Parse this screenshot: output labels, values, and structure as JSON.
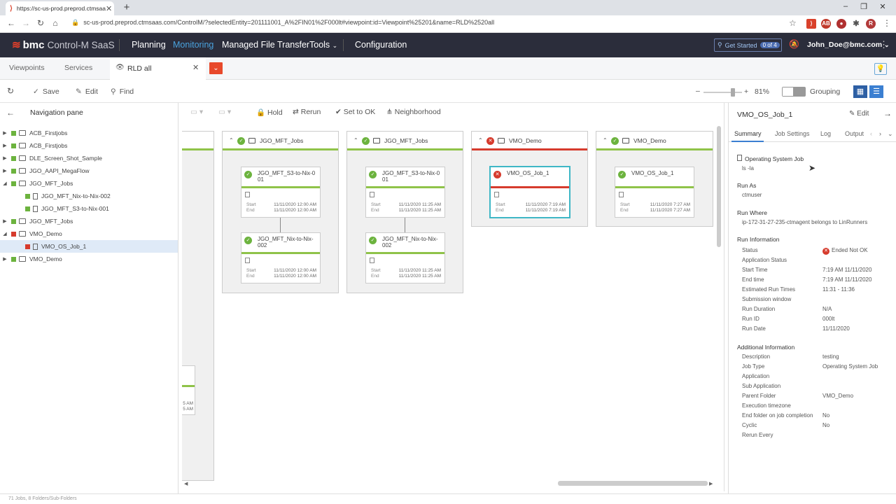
{
  "browser": {
    "tab_title": "https://sc-us-prod.preprod.ctmsaa",
    "url": "sc-us-prod.preprod.ctmsaas.com/ControlM/?selectedEntity=201111001_A%2FIN01%2F000lt#viewpoint:id=Viewpoint%25201&name=RLD%2520all",
    "profile_initial": "R"
  },
  "header": {
    "brand": "bmc",
    "product": "Control-M SaaS",
    "menu": [
      "Planning",
      "Monitoring",
      "Managed File Transfer",
      "Tools",
      "Configuration"
    ],
    "active_menu": "Monitoring",
    "get_started": "Get Started",
    "get_started_count": "0 of 4",
    "user": "John_Doe@bmc.com"
  },
  "viewpoint_tabs": {
    "viewpoints": "Viewpoints",
    "services": "Services",
    "active": "RLD all"
  },
  "toolbar": {
    "save": "Save",
    "edit": "Edit",
    "find": "Find",
    "zoom": "81%",
    "grouping": "Grouping"
  },
  "nav": {
    "title": "Navigation pane",
    "items": [
      {
        "label": "ACB_Firstjobs",
        "status": "ok"
      },
      {
        "label": "ACB_Firstjobs",
        "status": "ok"
      },
      {
        "label": "DLE_Screen_Shot_Sample",
        "status": "ok"
      },
      {
        "label": "JGO_AAPI_MegaFlow",
        "status": "ok"
      },
      {
        "label": "JGO_MFT_Jobs",
        "status": "ok"
      },
      {
        "label": "JGO_MFT_Nix-to-Nix-002",
        "status": "ok"
      },
      {
        "label": "JGO_MFT_S3-to-Nix-001",
        "status": "ok"
      },
      {
        "label": "JGO_MFT_Jobs",
        "status": "ok"
      },
      {
        "label": "VMO_Demo",
        "status": "fail"
      },
      {
        "label": "VMO_OS_Job_1",
        "status": "fail"
      },
      {
        "label": "VMO_Demo",
        "status": "ok"
      }
    ]
  },
  "canvas_toolbar": {
    "hold": "Hold",
    "rerun": "Rerun",
    "set_to_ok": "Set to OK",
    "neighborhood": "Neighborhood"
  },
  "folders": [
    {
      "name": "JGO_MFT_Jobs",
      "jobs": [
        {
          "name": "JGO_MFT_S3-to-Nix-0 01",
          "start": "11/11/2020 12:00 AM",
          "end": "11/11/2020 12:00 AM"
        },
        {
          "name": "JGO_MFT_Nix-to-Nix-002",
          "start": "11/11/2020 12:00 AM",
          "end": "11/11/2020 12:00 AM"
        }
      ]
    },
    {
      "name": "JGO_MFT_Jobs",
      "jobs": [
        {
          "name": "JGO_MFT_S3-to-Nix-0 01",
          "start": "11/11/2020 11:25 AM",
          "end": "11/11/2020 11:25 AM"
        },
        {
          "name": "JGO_MFT_Nix-to-Nix-002",
          "start": "11/11/2020 11:25 AM",
          "end": "11/11/2020 11:25 AM"
        }
      ]
    },
    {
      "name": "VMO_Demo",
      "jobs": [
        {
          "name": "VMO_OS_Job_1",
          "start": "11/11/2020 7:19 AM",
          "end": "11/11/2020 7:19 AM"
        }
      ]
    },
    {
      "name": "VMO_Demo",
      "jobs": [
        {
          "name": "VMO_OS_Job_1",
          "start": "11/11/2020 7:27 AM",
          "end": "11/11/2020 7:27 AM"
        }
      ]
    }
  ],
  "job_labels": {
    "start": "Start",
    "end": "End"
  },
  "partial_job_times": {
    "start": "5 AM",
    "end": "5 AM"
  },
  "status_bar": "71 Jobs, 8 Folders/Sub-Folders",
  "detail": {
    "title": "VMO_OS_Job_1",
    "edit": "Edit",
    "tabs": [
      "Summary",
      "Job Settings",
      "Log",
      "Output"
    ],
    "job_kind": "Operating System Job",
    "command": "ls -la",
    "run_as_label": "Run As",
    "run_as": "ctmuser",
    "run_where_label": "Run Where",
    "run_where": "ip-172-31-27-235-ctmagent belongs to LinRunners",
    "run_info_label": "Run Information",
    "run_info": [
      {
        "k": "Status",
        "v": "Ended Not OK"
      },
      {
        "k": "Application Status",
        "v": ""
      },
      {
        "k": "Start Time",
        "v": "7:19 AM 11/11/2020"
      },
      {
        "k": "End time",
        "v": "7:19 AM 11/11/2020"
      },
      {
        "k": "Estimated Run Times",
        "v": "11:31 - 11:36"
      },
      {
        "k": "Submission window",
        "v": ""
      },
      {
        "k": "Run Duration",
        "v": "N/A"
      },
      {
        "k": "Run ID",
        "v": "000lt"
      },
      {
        "k": "Run Date",
        "v": "11/11/2020"
      }
    ],
    "additional_label": "Additional Information",
    "additional": [
      {
        "k": "Description",
        "v": "testing"
      },
      {
        "k": "Job Type",
        "v": "Operating System Job"
      },
      {
        "k": "Application",
        "v": ""
      },
      {
        "k": "Sub Application",
        "v": ""
      },
      {
        "k": "Parent Folder",
        "v": "VMO_Demo"
      },
      {
        "k": "Execution timezone",
        "v": ""
      },
      {
        "k": "End folder on job completion",
        "v": "No"
      },
      {
        "k": "Cyclic",
        "v": "No"
      },
      {
        "k": "Rerun Every",
        "v": ""
      }
    ]
  },
  "colors": {
    "ok": "#6cb33e",
    "fail": "#d63b2d",
    "accent": "#3b7fd1",
    "header_bg": "#2b2d3b",
    "selected_job_border": "#3fb7c6"
  }
}
